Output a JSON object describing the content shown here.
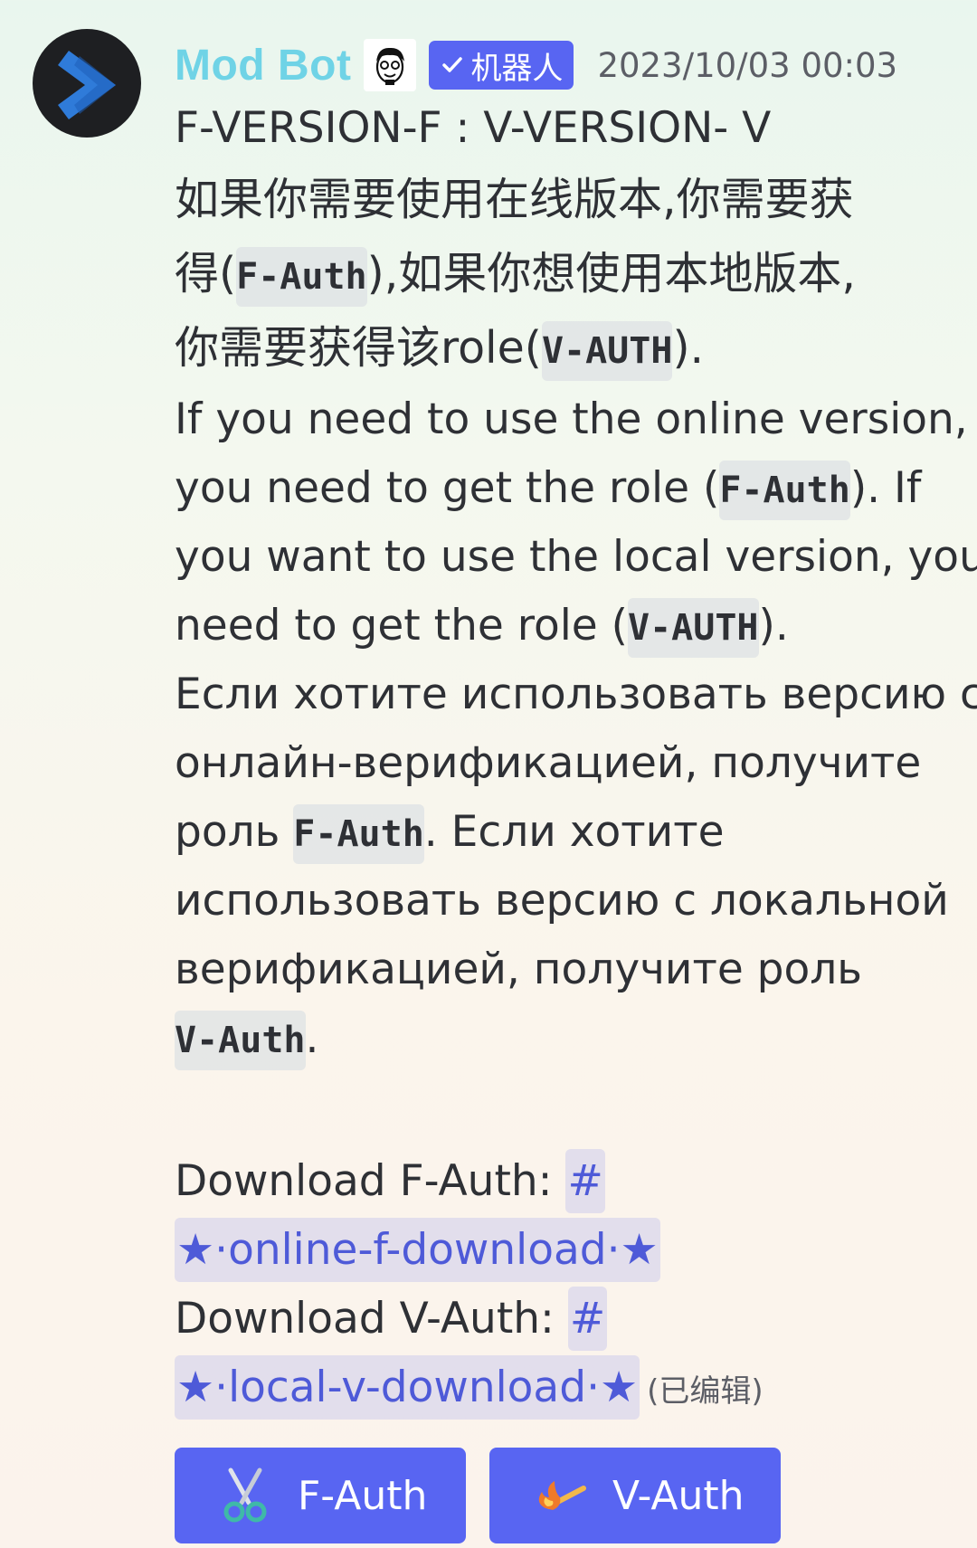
{
  "author": {
    "name": "Mod Bot",
    "bot_tag": "机器人",
    "timestamp": "2023/10/03 00:03",
    "avatar_icon": "arrow-chevron-logo",
    "badge_icon": "cartoon-face-emoji"
  },
  "message": {
    "version_line": "F-VERSION-F : V-VERSION- V",
    "cn": {
      "l1": "如果你需要使用在线版本,你需要获",
      "l2a": "得(",
      "l2code": "F-Auth",
      "l2b": "),如果你想使用本地版本,",
      "l3a": "你需要获得该role(",
      "l3code": "V-AUTH",
      "l3b": ")."
    },
    "en": {
      "l1": "If you need to use the online version,",
      "l2a": "you need to get the role (",
      "l2code": "F-Auth",
      "l2b": "). If",
      "l3": "you want to use the local version, you",
      "l4a": "need to get the role (",
      "l4code": "V-AUTH",
      "l4b": ")."
    },
    "ru": {
      "l1": "Если хотите использовать версию с",
      "l2": "онлайн-верификацией, получите",
      "l3a": "роль ",
      "l3code": "F-Auth",
      "l3b": ". Если хотите",
      "l4": "использовать версию с локальной",
      "l5": "верификацией, получите роль",
      "l6code": "V-Auth",
      "l6b": "."
    },
    "downloads": {
      "f_label": "Download F-Auth: ",
      "f_hash": "#",
      "f_channel": "★·online-f-download·★",
      "v_label": "Download V-Auth: ",
      "v_hash": "#",
      "v_channel": "★·local-v-download·★"
    },
    "edited": "(已编辑)"
  },
  "buttons": [
    {
      "label": "F-Auth",
      "icon": "scissors-icon"
    },
    {
      "label": "V-Auth",
      "icon": "match-icon"
    }
  ],
  "colors": {
    "username": "#6fd3e6",
    "blurple": "#5865f2",
    "channel_link": "#4e5ad8",
    "text": "#2e3035",
    "muted": "#5c5e66"
  }
}
